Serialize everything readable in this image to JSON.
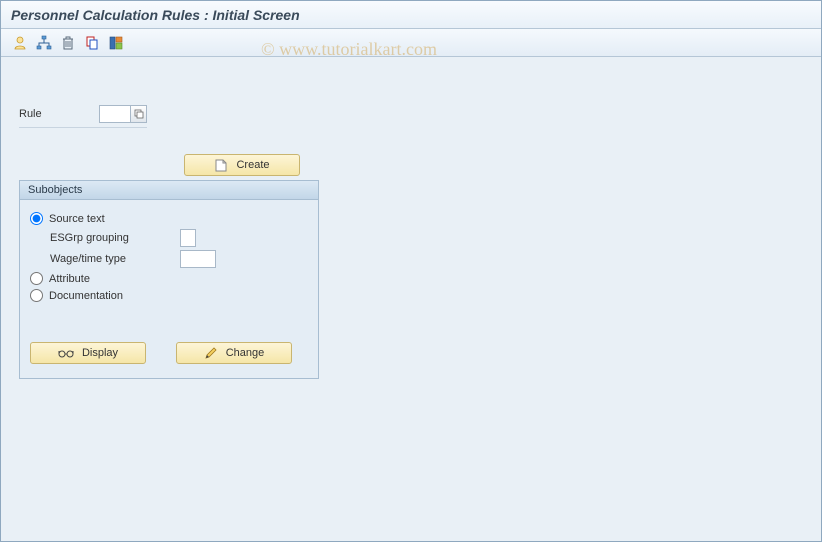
{
  "title": "Personnel Calculation Rules : Initial Screen",
  "watermark": "© www.tutorialkart.com",
  "toolbar": {
    "icons": [
      "user-icon",
      "hierarchy-icon",
      "delete-icon",
      "copy-icon",
      "layout-icon"
    ]
  },
  "fields": {
    "rule_label": "Rule",
    "rule_value": "",
    "esgrp_label": "ESGrp grouping",
    "esgrp_value": "",
    "wagetype_label": "Wage/time type",
    "wagetype_value": ""
  },
  "buttons": {
    "create": "Create",
    "display": "Display",
    "change": "Change"
  },
  "groupbox": {
    "title": "Subobjects"
  },
  "radios": {
    "source_text": "Source text",
    "attribute": "Attribute",
    "documentation": "Documentation",
    "selected": "source_text"
  }
}
